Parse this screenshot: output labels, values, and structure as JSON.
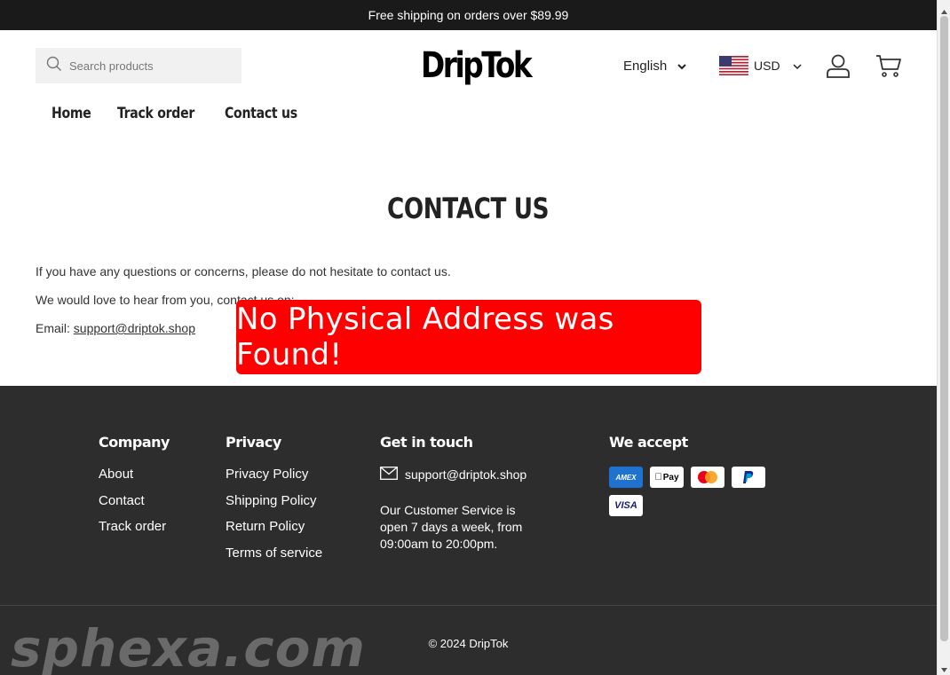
{
  "announcement": "Free shipping on orders over $89.99",
  "header": {
    "search_placeholder": "Search products",
    "logo_text": "DripTok",
    "language": "English",
    "currency": "USD",
    "icons": [
      "search-icon",
      "chevron-down-icon",
      "us-flag-icon",
      "account-icon",
      "cart-icon"
    ]
  },
  "nav": {
    "items": [
      {
        "label": "Home"
      },
      {
        "label": "Track order"
      },
      {
        "label": "Contact us"
      }
    ]
  },
  "main": {
    "title": "CONTACT US",
    "intro": "If you have any questions or concerns, please do not hesitate to contact us.",
    "line2": "We would love to hear from you, contact us on:",
    "email_label": "Email: ",
    "email": " support@driptok.shop"
  },
  "overlay": {
    "text": "No Physical Address was Found!",
    "color": "#ff0000"
  },
  "footer": {
    "company": {
      "heading": "Company",
      "links": [
        "About",
        "Contact",
        "Track order"
      ]
    },
    "privacy": {
      "heading": "Privacy",
      "links": [
        "Privacy Policy",
        "Shipping Policy",
        "Return Policy",
        "Terms of service"
      ]
    },
    "contact": {
      "heading": "Get in touch",
      "email": "support@driptok.shop",
      "hours": "Our Customer Service is open 7 days a week, from 09:00am to 20:00pm."
    },
    "payments": {
      "heading": "We accept",
      "cards": [
        {
          "name": "AMEX",
          "color": "#1f72cd"
        },
        {
          "name": "Apple Pay",
          "color": "#000000"
        },
        {
          "name": "Mastercard",
          "color": "#eb001b"
        },
        {
          "name": "PayPal",
          "color": "#003087"
        },
        {
          "name": "VISA",
          "color": "#1a1f71"
        }
      ]
    },
    "copyright": "© 2024 DripTok",
    "watermark": "sphexa.com"
  }
}
